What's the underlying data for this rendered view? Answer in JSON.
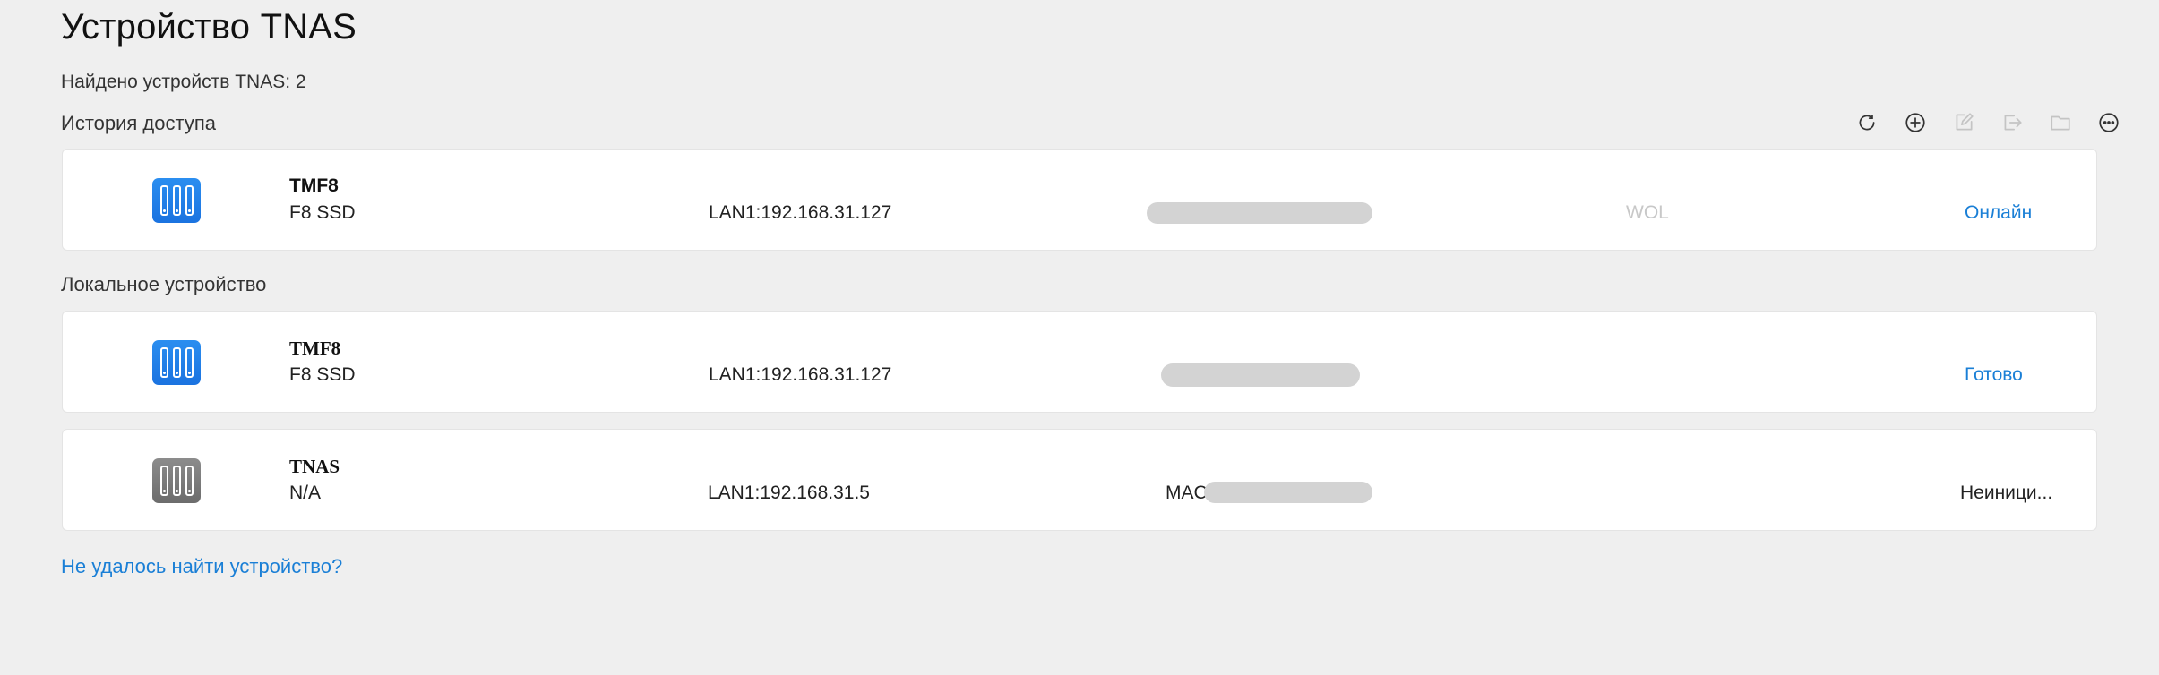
{
  "page": {
    "title": "Устройство TNAS",
    "found_text": "Найдено устройств TNAS: 2",
    "help_link": "Не удалось найти устройство?"
  },
  "toolbar": [
    {
      "name": "refresh-icon"
    },
    {
      "name": "add-icon"
    },
    {
      "name": "edit-icon"
    },
    {
      "name": "export-icon"
    },
    {
      "name": "folder-icon"
    },
    {
      "name": "more-icon"
    }
  ],
  "history": {
    "label": "История доступа",
    "devices": [
      {
        "name": "TMF8",
        "model": "F8 SSD",
        "ip": "LAN1:192.168.31.127",
        "wol": "WOL",
        "status": "Онлайн",
        "icon": "nas-blue-icon"
      }
    ]
  },
  "local": {
    "label": "Локальное устройство",
    "devices": [
      {
        "name": "TMF8",
        "model": "F8 SSD",
        "ip": "LAN1:192.168.31.127",
        "status": "Готово",
        "icon": "nas-blue-icon"
      },
      {
        "name": "TNAS",
        "model": "N/A",
        "ip": "LAN1:192.168.31.5",
        "mac_label": "MAC",
        "status": "Неиници...",
        "icon": "nas-gray-icon"
      }
    ]
  },
  "colors": {
    "background": "#efefef",
    "card": "#ffffff",
    "accent": "#1a7fd6",
    "disabled": "#c8c8c8"
  }
}
